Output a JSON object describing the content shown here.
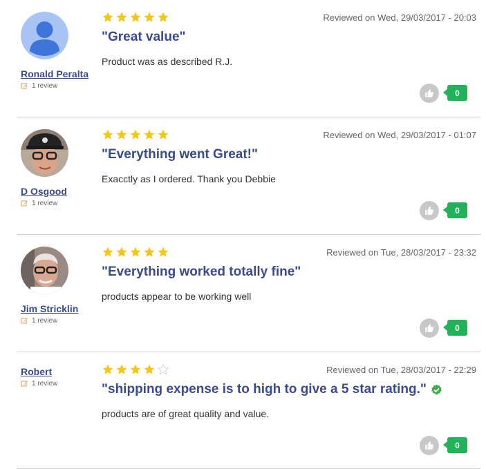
{
  "reviews": [
    {
      "author": "Ronald Peralta",
      "review_count": "1 review",
      "avatar": "default-user",
      "rating": 5,
      "date": "Reviewed on Wed, 29/03/2017 - 20:03",
      "title": "\"Great value\"",
      "body": "Product was as described R.J.",
      "likes": "0",
      "verified": false
    },
    {
      "author": "D Osgood",
      "review_count": "1 review",
      "avatar": "photo-woman-cap-glasses",
      "rating": 5,
      "date": "Reviewed on Wed, 29/03/2017 - 01:07",
      "title": "\"Everything went Great!\"",
      "body": "Exacctly as I ordered. Thank you Debbie",
      "likes": "0",
      "verified": false
    },
    {
      "author": "Jim Stricklin",
      "review_count": "1 review",
      "avatar": "photo-man-glasses",
      "rating": 5,
      "date": "Reviewed on Tue, 28/03/2017 - 23:32",
      "title": "\"Everything worked totally fine\"",
      "body": "products appear to be working well",
      "likes": "0",
      "verified": false
    },
    {
      "author": "Robert",
      "review_count": "1 review",
      "avatar": "none",
      "rating": 4,
      "date": "Reviewed on Tue, 28/03/2017 - 22:29",
      "title": "\"shipping expense is to high to give a 5 star rating.\"",
      "body": "products are of great quality and value.",
      "likes": "0",
      "verified": true
    }
  ],
  "colors": {
    "star_filled": "#f5c518",
    "link_blue": "#3b4a8c",
    "like_green": "#22b35a",
    "verified_green": "#3cae4c"
  }
}
